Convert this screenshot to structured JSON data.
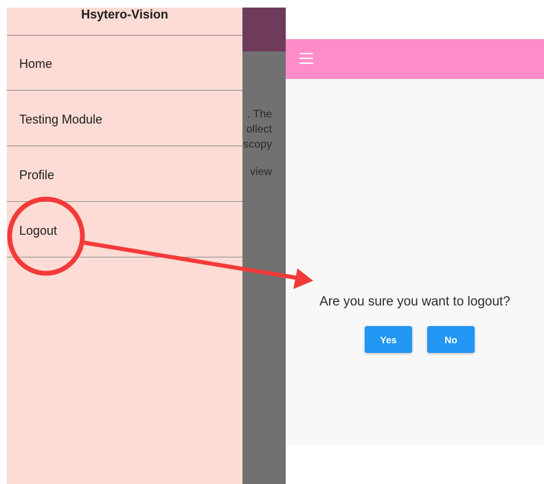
{
  "left_screen": {
    "drawer": {
      "title": "Hsytero-Vision",
      "items": [
        {
          "label": "Home"
        },
        {
          "label": "Testing Module"
        },
        {
          "label": "Profile"
        },
        {
          "label": "Logout"
        }
      ]
    },
    "background_text": [
      ". The",
      "ollect",
      "scopy",
      "view"
    ]
  },
  "right_screen": {
    "appbar": {
      "menu_icon": "menu-icon"
    },
    "dialog": {
      "message": "Are you sure you want to logout?",
      "yes_label": "Yes",
      "no_label": "No"
    }
  },
  "colors": {
    "drawer_bg": "#fcdcd4",
    "left_appbar": "#6e3c5a",
    "right_appbar": "#fd8cc9",
    "button": "#2196f3",
    "annotation": "#f33a3a"
  }
}
